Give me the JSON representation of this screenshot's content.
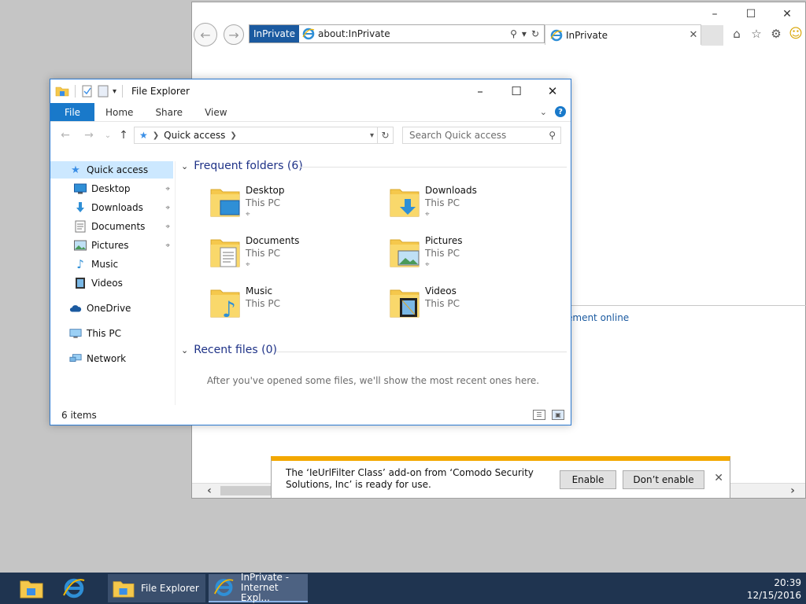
{
  "ie": {
    "address_badge": "InPrivate",
    "address_url": "about:InPrivate",
    "tab_title": "InPrivate",
    "link_text_partial": "ement online",
    "icons": [
      "back-icon",
      "forward-icon",
      "search-icon",
      "refresh-icon",
      "home-icon",
      "favorites-icon",
      "settings-icon",
      "smiley-icon"
    ]
  },
  "notification": {
    "message": "The ‘IeUrlFilter Class’ add-on from ‘Comodo Security Solutions, Inc’ is ready for use.",
    "enable_label": "Enable",
    "dont_enable_label": "Don’t enable"
  },
  "explorer": {
    "title": "File Explorer",
    "ribbon_tabs": [
      "File",
      "Home",
      "Share",
      "View"
    ],
    "breadcrumb": "Quick access",
    "search_placeholder": "Search Quick access",
    "nav": [
      {
        "label": "Quick access",
        "icon": "star-icon",
        "pinned": false,
        "selected": true
      },
      {
        "label": "Desktop",
        "icon": "desktop-icon",
        "pinned": true
      },
      {
        "label": "Downloads",
        "icon": "downloads-icon",
        "pinned": true
      },
      {
        "label": "Documents",
        "icon": "documents-icon",
        "pinned": true
      },
      {
        "label": "Pictures",
        "icon": "pictures-icon",
        "pinned": true
      },
      {
        "label": "Music",
        "icon": "music-icon",
        "pinned": false
      },
      {
        "label": "Videos",
        "icon": "videos-icon",
        "pinned": false
      },
      {
        "label": "OneDrive",
        "icon": "cloud-icon",
        "pinned": false
      },
      {
        "label": "This PC",
        "icon": "computer-icon",
        "pinned": false
      },
      {
        "label": "Network",
        "icon": "network-icon",
        "pinned": false
      }
    ],
    "frequent_header": "Frequent folders (6)",
    "folders": [
      {
        "name": "Desktop",
        "location": "This PC",
        "pinned": true
      },
      {
        "name": "Downloads",
        "location": "This PC",
        "pinned": true
      },
      {
        "name": "Documents",
        "location": "This PC",
        "pinned": true
      },
      {
        "name": "Pictures",
        "location": "This PC",
        "pinned": true
      },
      {
        "name": "Music",
        "location": "This PC",
        "pinned": false
      },
      {
        "name": "Videos",
        "location": "This PC",
        "pinned": false
      }
    ],
    "recent_header": "Recent files (0)",
    "recent_empty": "After you've opened some files, we'll show the most recent ones here.",
    "status": "6 items"
  },
  "taskbar": {
    "apps": [
      {
        "label": "File Explorer"
      },
      {
        "label_line1": "InPrivate -",
        "label_line2": "Internet Expl..."
      }
    ],
    "time": "20:39",
    "date": "12/15/2016"
  },
  "colors": {
    "accent": "#1979ca",
    "inprivate": "#1b5aa0",
    "taskbar": "#1f3450",
    "notification_bar": "#f3a800",
    "folder_yellow": "#f5c84c"
  }
}
